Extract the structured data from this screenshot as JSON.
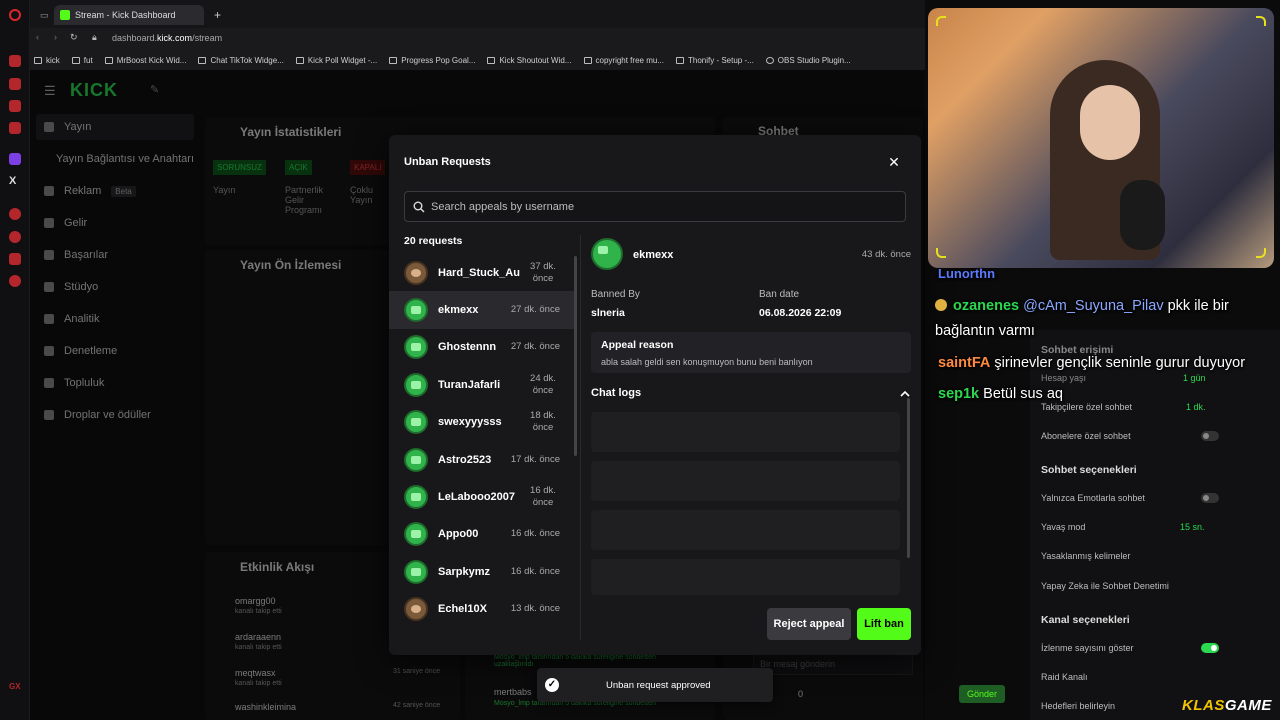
{
  "browser": {
    "tab_title": "Stream - Kick Dashboard",
    "url_domain": "dashboard.",
    "url_host": "kick.com",
    "url_path": "/stream",
    "bookmarks": [
      "kick",
      "fut",
      "MrBoost Kick Wid...",
      "Chat TikTok Widge...",
      "Kick Poll Widget -...",
      "Progress Pop Goal...",
      "Kick Shoutout Wid...",
      "copyright free mu...",
      "Thonify - Setup -...",
      "OBS Studio Plugin..."
    ]
  },
  "sidebar": {
    "logo": "KICK",
    "items": [
      {
        "label": "Yayın"
      },
      {
        "label": "Yayın Bağlantısı ve Anahtarı"
      },
      {
        "label": "Reklam",
        "badge": "Beta"
      },
      {
        "label": "Gelir"
      },
      {
        "label": "Başarılar"
      },
      {
        "label": "Stüdyo"
      },
      {
        "label": "Analitik"
      },
      {
        "label": "Denetleme"
      },
      {
        "label": "Topluluk"
      },
      {
        "label": "Droplar ve ödüller"
      }
    ]
  },
  "dashboard": {
    "stats_title": "Yayın İstatistikleri",
    "preview_title": "Yayın Ön İzlemesi",
    "activity_title": "Etkinlik Akışı",
    "chat_title": "Sohbet",
    "badges": [
      "SORUNSUZ",
      "AÇIK",
      "KAPALI"
    ],
    "stat_labels": [
      "Yayın",
      "Partnerlik Gelir Programı",
      "Çoklu Yayın"
    ],
    "activity": [
      {
        "name": "omargg00",
        "sub": "kanalı takip etti"
      },
      {
        "name": "ardaraaenn",
        "sub": "kanalı takip etti"
      },
      {
        "name": "meqtwasx",
        "sub": "kanalı takip etti",
        "time": "31 saniye önce"
      },
      {
        "name": "washinkleimina",
        "time": "42 saniye önce"
      }
    ],
    "chat_bottom": {
      "placeholder": "Bir mesaj gönderin",
      "send": "Gönder",
      "count": "0"
    },
    "mod_log_1": "Mosyo_lmp tarafından 5 dakika süreliğine sohbetten uzaklaştırıldı",
    "mod_log_2_name": "mertbabs",
    "mod_log_2": "Mosyo_lmp tarafından 5 dakika süreliğine sohbetten"
  },
  "modal": {
    "title": "Unban Requests",
    "search_placeholder": "Search appeals by username",
    "count_label": "20 requests",
    "requests": [
      {
        "name": "Hard_Stuck_Au",
        "time": "37 dk. önce",
        "alt": true
      },
      {
        "name": "ekmexx",
        "time": "27 dk. önce",
        "selected": true
      },
      {
        "name": "Ghostennn",
        "time": "27 dk. önce"
      },
      {
        "name": "TuranJafarli",
        "time": "24 dk. önce"
      },
      {
        "name": "swexyyysss",
        "time": "18 dk. önce"
      },
      {
        "name": "Astro2523",
        "time": "17 dk. önce"
      },
      {
        "name": "LeLabooo2007",
        "time": "16 dk. önce"
      },
      {
        "name": "Appo00",
        "time": "16 dk. önce"
      },
      {
        "name": "Sarpkymz",
        "time": "16 dk. önce"
      },
      {
        "name": "Echel10X",
        "time": "13 dk. önce",
        "alt": true
      }
    ],
    "detail": {
      "username": "ekmexx",
      "time": "43 dk. önce",
      "banned_by_label": "Banned By",
      "banned_by": "slneria",
      "ban_date_label": "Ban date",
      "ban_date": "06.08.2026 22:09",
      "appeal_reason_label": "Appeal reason",
      "appeal_reason": "abla salah geldi sen konuşmuyon bunu beni banlıyon",
      "chat_logs_label": "Chat logs"
    },
    "reject_label": "Reject appeal",
    "lift_label": "Lift ban"
  },
  "toast": {
    "message": "Unban request approved"
  },
  "stream_chat": [
    {
      "name": "Lunorthn",
      "color": "#5b7bff",
      "text": ""
    },
    {
      "name": "ozanenes",
      "color": "#2bd84f",
      "text": "@cAm_Suyuna_Pilav pkk ile bir",
      "mention": "@cAm_Suyuna_Pilav",
      "rest": " pkk ile bir"
    },
    {
      "text": "bağlantın varmı"
    },
    {
      "name": "saintFA",
      "color": "#ff8a3d",
      "text": "şirinevler gençlik seninle gurur duyuyor"
    },
    {
      "name": "sep1k",
      "color": "#2bd84f",
      "text": "Betül sus aq"
    }
  ],
  "right_panel": {
    "section1": "Sohbet erişimi",
    "rows1": [
      {
        "label": "Hesap yaşı",
        "value": "1 gün"
      },
      {
        "label": "Takipçilere özel sohbet",
        "value": "1 dk."
      },
      {
        "label": "Abonelere özel sohbet"
      }
    ],
    "section2": "Sohbet seçenekleri",
    "rows2": [
      {
        "label": "Yalnızca Emotlarla sohbet"
      },
      {
        "label": "Yavaş mod",
        "value": "15 sn."
      },
      {
        "label": "Yasaklanmış kelimeler"
      },
      {
        "label": "Yapay Zeka ile Sohbet Denetimi"
      }
    ],
    "section3": "Kanal seçenekleri",
    "rows3": [
      {
        "label": "İzlenme sayısını göster"
      },
      {
        "label": "Raid Kanalı"
      },
      {
        "label": "Hedefleri belirleyin"
      }
    ]
  },
  "watermark": {
    "part1": "KLAS",
    "part2": "GAME"
  },
  "colors": {
    "kick_green": "#53fc18",
    "modal_bg": "#18181b",
    "selected_row": "#2a2a2e"
  }
}
